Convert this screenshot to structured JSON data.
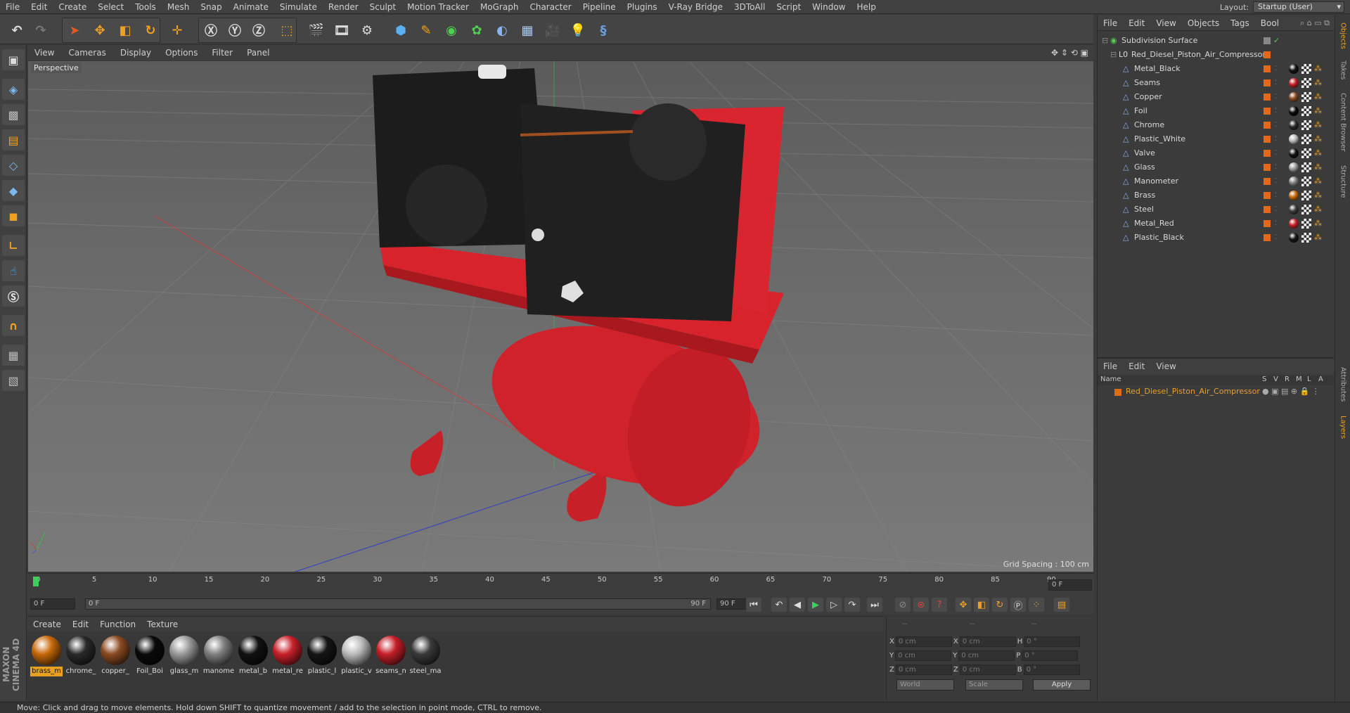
{
  "menubar": {
    "items": [
      "File",
      "Edit",
      "Create",
      "Select",
      "Tools",
      "Mesh",
      "Snap",
      "Animate",
      "Simulate",
      "Render",
      "Sculpt",
      "Motion Tracker",
      "MoGraph",
      "Character",
      "Pipeline",
      "Plugins",
      "V-Ray Bridge",
      "3DToAll",
      "Script",
      "Window",
      "Help"
    ]
  },
  "layout": {
    "label": "Layout:",
    "value": "Startup (User)"
  },
  "viewport": {
    "menu": [
      "View",
      "Cameras",
      "Display",
      "Options",
      "Filter",
      "Panel"
    ],
    "camera_label": "Perspective",
    "grid_spacing": "Grid Spacing : 100 cm"
  },
  "timeline": {
    "ticks": [
      "0",
      "5",
      "10",
      "15",
      "20",
      "25",
      "30",
      "35",
      "40",
      "45",
      "50",
      "55",
      "60",
      "65",
      "70",
      "75",
      "80",
      "85",
      "90"
    ],
    "current_frame_right": "0 F",
    "start_field": "0 F",
    "range_start": "0 F",
    "range_end": "90 F",
    "end_field": "90 F",
    "current_frame_fraction": 0
  },
  "materials": {
    "menu": [
      "Create",
      "Edit",
      "Function",
      "Texture"
    ],
    "items": [
      {
        "label": "brass_m",
        "color": "#c86a0a",
        "selected": true
      },
      {
        "label": "chrome_",
        "color": "#2a2a2a"
      },
      {
        "label": "copper_",
        "color": "#8a4a22"
      },
      {
        "label": "Foil_Boi",
        "color": "#0a0a0a"
      },
      {
        "label": "glass_m",
        "color": "#9a9a9a"
      },
      {
        "label": "manome",
        "color": "#808080"
      },
      {
        "label": "metal_b",
        "color": "#111111"
      },
      {
        "label": "metal_re",
        "color": "#c8202a"
      },
      {
        "label": "plastic_l",
        "color": "#151515"
      },
      {
        "label": "plastic_v",
        "color": "#bdbdbd"
      },
      {
        "label": "seams_n",
        "color": "#c51e28"
      },
      {
        "label": "steel_ma",
        "color": "#3a3a3a"
      }
    ]
  },
  "coordinates": {
    "header_left": "--",
    "header_mid": "--",
    "header_right": "--",
    "rows": [
      {
        "a": "X",
        "av": "0 cm",
        "b": "X",
        "bv": "0 cm",
        "c": "H",
        "cv": "0 °"
      },
      {
        "a": "Y",
        "av": "0 cm",
        "b": "Y",
        "bv": "0 cm",
        "c": "P",
        "cv": "0 °"
      },
      {
        "a": "Z",
        "av": "0 cm",
        "b": "Z",
        "bv": "0 cm",
        "c": "B",
        "cv": "0 °"
      }
    ],
    "mode1": "World",
    "mode2": "Scale",
    "apply": "Apply"
  },
  "status": "Move: Click and drag to move elements. Hold down SHIFT to quantize movement / add to the selection in point mode, CTRL to remove.",
  "logo": "MAXON CINEMA 4D",
  "objects": {
    "menu": [
      "File",
      "Edit",
      "View",
      "Objects",
      "Tags",
      "Bool"
    ],
    "root": "Subdivision Surface",
    "group": "Red_Diesel_Piston_Air_Compressor",
    "children": [
      {
        "name": "Metal_Black",
        "mat": "#111111"
      },
      {
        "name": "Seams",
        "mat": "#c51e28"
      },
      {
        "name": "Copper",
        "mat": "#8a4a22"
      },
      {
        "name": "Foil",
        "mat": "#0a0a0a"
      },
      {
        "name": "Chrome",
        "mat": "#2a2a2a"
      },
      {
        "name": "Plastic_White",
        "mat": "#bdbdbd"
      },
      {
        "name": "Valve",
        "mat": "#111111"
      },
      {
        "name": "Glass",
        "mat": "#9a9a9a"
      },
      {
        "name": "Manometer",
        "mat": "#808080"
      },
      {
        "name": "Brass",
        "mat": "#c86a0a"
      },
      {
        "name": "Steel",
        "mat": "#3a3a3a"
      },
      {
        "name": "Metal_Red",
        "mat": "#c8202a"
      },
      {
        "name": "Plastic_Black",
        "mat": "#151515"
      }
    ]
  },
  "layers": {
    "menu": [
      "File",
      "Edit",
      "View"
    ],
    "columns": [
      "Name",
      "S",
      "V",
      "R",
      "M",
      "L",
      "A"
    ],
    "rows": [
      "Red_Diesel_Piston_Air_Compressor"
    ]
  },
  "right_tabs": [
    "Objects",
    "Takes",
    "Content Browser",
    "Structure",
    "Attributes",
    "Layers"
  ]
}
